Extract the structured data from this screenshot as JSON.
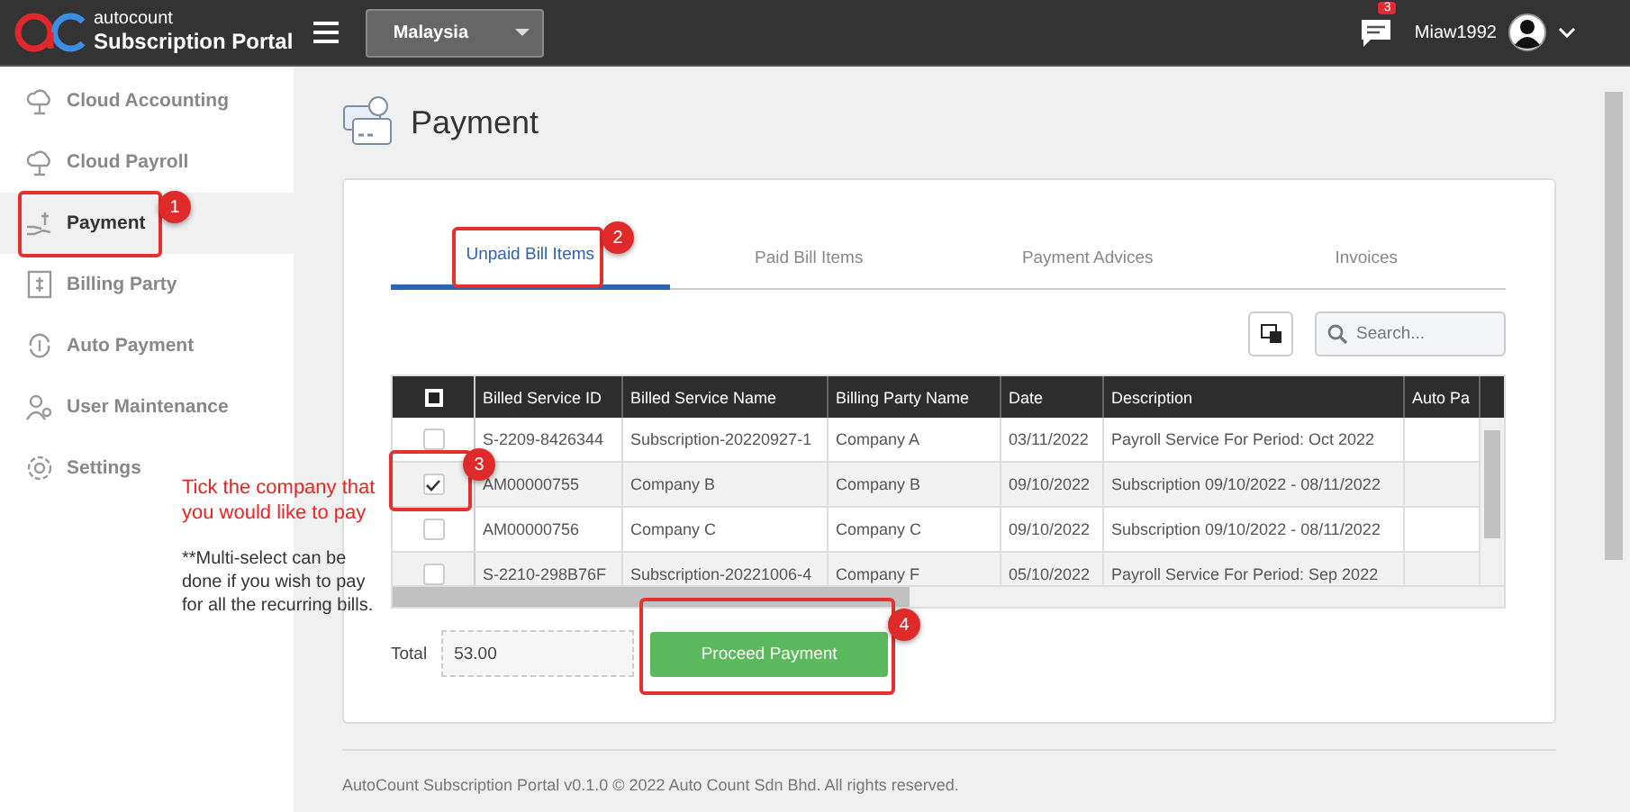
{
  "header": {
    "logo_top": "autocount",
    "logo_bottom": "Subscription Portal",
    "country": "Malaysia",
    "notification_count": "3",
    "username": "Miaw1992"
  },
  "sidebar": {
    "items": [
      {
        "label": "Cloud Accounting",
        "selected": false
      },
      {
        "label": "Cloud Payroll",
        "selected": false
      },
      {
        "label": "Payment",
        "selected": true
      },
      {
        "label": "Billing Party",
        "selected": false
      },
      {
        "label": "Auto Payment",
        "selected": false
      },
      {
        "label": "User Maintenance",
        "selected": false
      },
      {
        "label": "Settings",
        "selected": false
      }
    ]
  },
  "page": {
    "title": "Payment"
  },
  "tabs": [
    {
      "label": "Unpaid Bill Items",
      "selected": true
    },
    {
      "label": "Paid Bill Items",
      "selected": false
    },
    {
      "label": "Payment Advices",
      "selected": false
    },
    {
      "label": "Invoices",
      "selected": false
    }
  ],
  "search": {
    "placeholder": "Search..."
  },
  "table": {
    "select_all_partial": true,
    "columns": [
      "Billed Service ID",
      "Billed Service Name",
      "Billing Party Name",
      "Date",
      "Description",
      "Auto Pa"
    ],
    "rows": [
      {
        "checked": false,
        "cells": [
          "S-2209-8426344",
          "Subscription-20220927-1",
          "Company A",
          "03/11/2022",
          "Payroll Service For Period: Oct 2022"
        ]
      },
      {
        "checked": true,
        "cells": [
          "AM00000755",
          "Company B",
          "Company B",
          "09/10/2022",
          "Subscription 09/10/2022 - 08/11/2022"
        ]
      },
      {
        "checked": false,
        "cells": [
          "AM00000756",
          "Company C",
          "Company C",
          "09/10/2022",
          "Subscription 09/10/2022 - 08/11/2022"
        ]
      },
      {
        "checked": false,
        "cells": [
          "S-2210-298B76F",
          "Subscription-20221006-4",
          "Company F",
          "05/10/2022",
          "Payroll Service For Period: Sep 2022"
        ]
      }
    ]
  },
  "total": {
    "label": "Total",
    "value": "53.00"
  },
  "proceed_button": "Proceed Payment",
  "footer": "AutoCount Subscription Portal v0.1.0 © 2022 Auto Count Sdn Bhd. All rights reserved.",
  "annotations": {
    "markers": [
      "1",
      "2",
      "3",
      "4"
    ],
    "tip": [
      "Tick the company that",
      "you would like to pay"
    ],
    "note": [
      "**Multi-select can be",
      "done if you wish to pay",
      "for all the recurring bills."
    ]
  }
}
